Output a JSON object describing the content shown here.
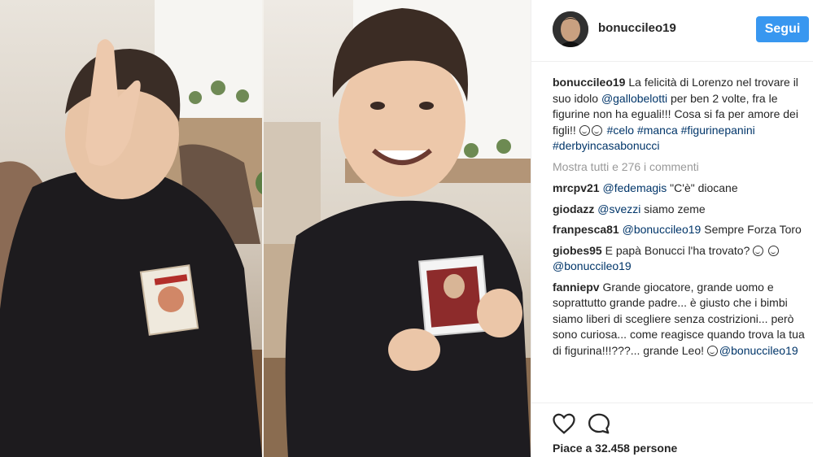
{
  "post": {
    "username": "bonucci​leo19",
    "follow_label": "Segui",
    "caption_user": "bonucci​leo19",
    "caption_parts": [
      "La felicità di Lorenzo nel trovare il suo idolo ",
      "@gallobelotti",
      " per ben 2 volte, fra le figurine non ha eguali!!! Cosa si fa per amore dei figli!! ",
      " ",
      "#celo",
      "#manca",
      "#figurinepanini",
      "#derbyincasabonucci"
    ],
    "show_all": "Mostra tutti e 276 i commenti",
    "comments": [
      {
        "user": "mrcpv21",
        "mention": "@fedemagis",
        "text": " \"C'è\" diocane"
      },
      {
        "user": "giodazz",
        "mention": "@svezzi",
        "text": " siamo zeme"
      },
      {
        "user": "franpesca81",
        "mention": "@bonucci​leo19",
        "text": " Sempre Forza Toro"
      },
      {
        "user": "giobes95",
        "text": "E papà Bonucci l'ha trovato? ",
        "mention_after": "@bonucci​leo19"
      },
      {
        "user": "fanniepv",
        "text": "Grande giocatore, grande uomo e soprattutto grande padre... è giusto che i bimbi siamo liberi di scegliere senza costrizioni... però sono curiosa... come reagisce quando trova la tua di figurina!!!???... grande Leo!",
        "mention_after": "@bonucci​leo19"
      }
    ],
    "likes_text": "Piace a 32.458 persone"
  },
  "icons": {
    "like": "heart-icon",
    "comment": "comment-icon"
  },
  "colors": {
    "accent": "#3897f0",
    "link": "#003569",
    "muted": "#999999"
  }
}
